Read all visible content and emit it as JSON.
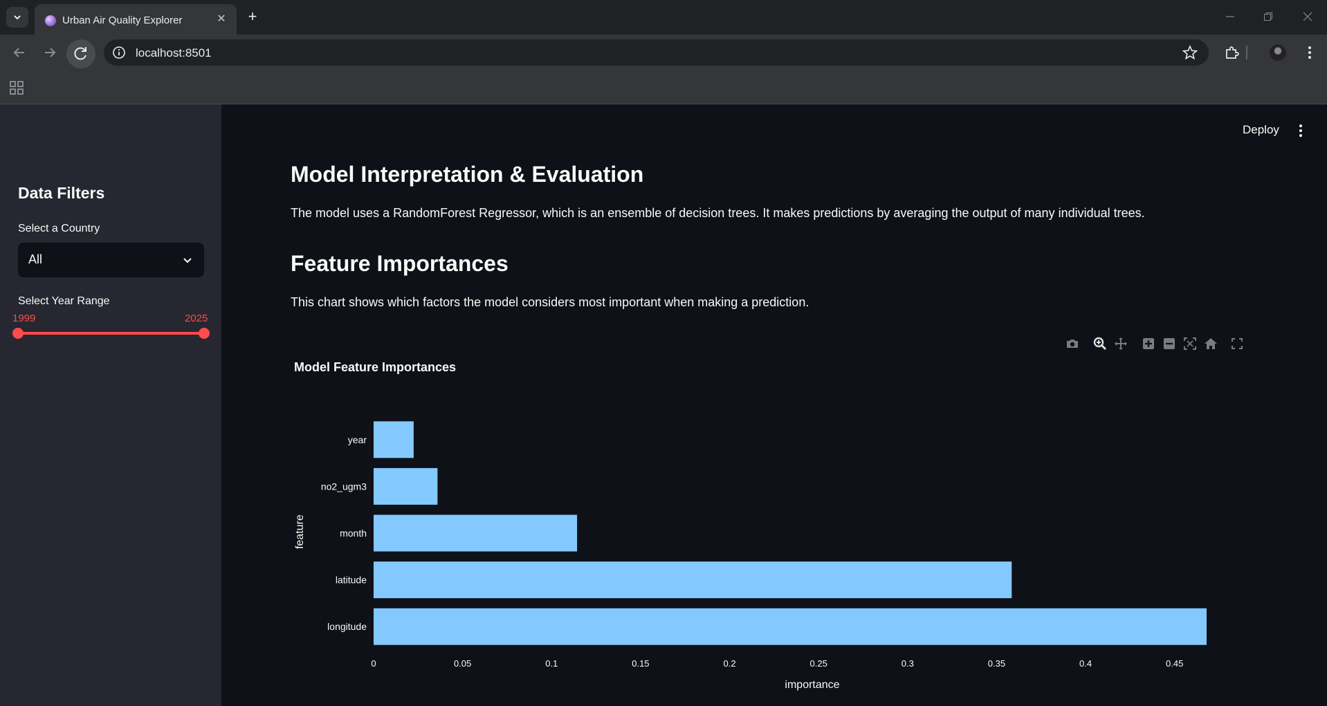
{
  "browser": {
    "tab_title": "Urban Air Quality Explorer",
    "url": "localhost:8501"
  },
  "sidebar": {
    "title": "Data Filters",
    "country_label": "Select a Country",
    "country_value": "All",
    "year_label": "Select Year Range",
    "year_min": "1999",
    "year_max": "2025"
  },
  "header": {
    "deploy_label": "Deploy"
  },
  "main": {
    "heading1": "Model Interpretation & Evaluation",
    "para1": "The model uses a RandomForest Regressor, which is an ensemble of decision trees. It makes predictions by averaging the output of many individual trees.",
    "heading2": "Feature Importances",
    "para2": "This chart shows which factors the model considers most important when making a prediction."
  },
  "colors": {
    "accent": "#ff4b4b",
    "bar": "#83c9ff",
    "background": "#0e1117",
    "sidebar": "#262730"
  },
  "chart_data": {
    "type": "bar",
    "orientation": "horizontal",
    "title": "Model Feature Importances",
    "xlabel": "importance",
    "ylabel": "feature",
    "categories": [
      "year",
      "no2_ugm3",
      "month",
      "latitude",
      "longitude"
    ],
    "values": [
      0.0225,
      0.0359,
      0.1143,
      0.3585,
      0.468
    ],
    "xlim": [
      0,
      0.468
    ],
    "xticks": [
      0,
      0.05,
      0.1,
      0.15,
      0.2,
      0.25,
      0.3,
      0.35,
      0.4,
      0.45
    ],
    "xtick_labels": [
      "0",
      "0.05",
      "0.1",
      "0.15",
      "0.2",
      "0.25",
      "0.3",
      "0.35",
      "0.4",
      "0.45"
    ],
    "grid": false
  }
}
